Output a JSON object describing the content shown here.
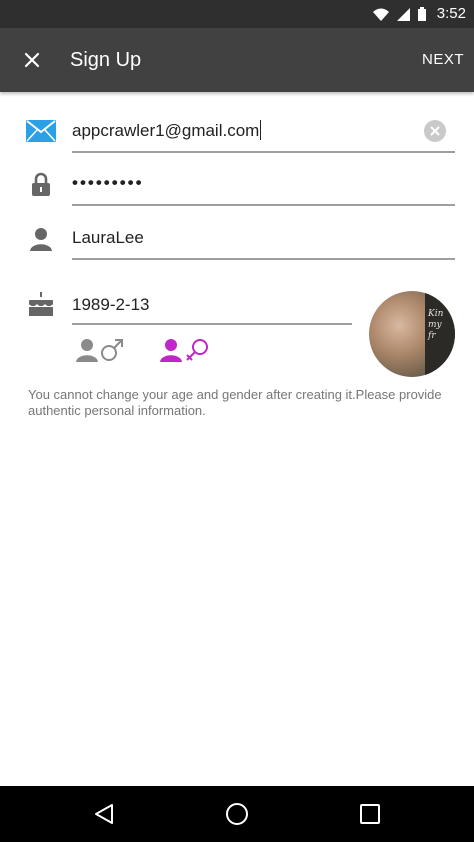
{
  "status_bar": {
    "time": "3:52"
  },
  "app_bar": {
    "title": "Sign Up",
    "next_label": "NEXT"
  },
  "form": {
    "email": "appcrawler1@gmail.com",
    "password": "•••••••••",
    "username": "LauraLee",
    "birthday": "1989-2-13"
  },
  "gender": {
    "selected": "female",
    "selected_color": "#c026c9",
    "unselected_color": "#8a8a8a"
  },
  "avatar": {
    "caption": "Kin my fr"
  },
  "note": "You cannot change your age and gender after creating it.Please provide authentic personal information.",
  "colors": {
    "app_bar": "#414141",
    "status_bar": "#2f2f2f",
    "accent_icon": "#2aa0e6"
  }
}
